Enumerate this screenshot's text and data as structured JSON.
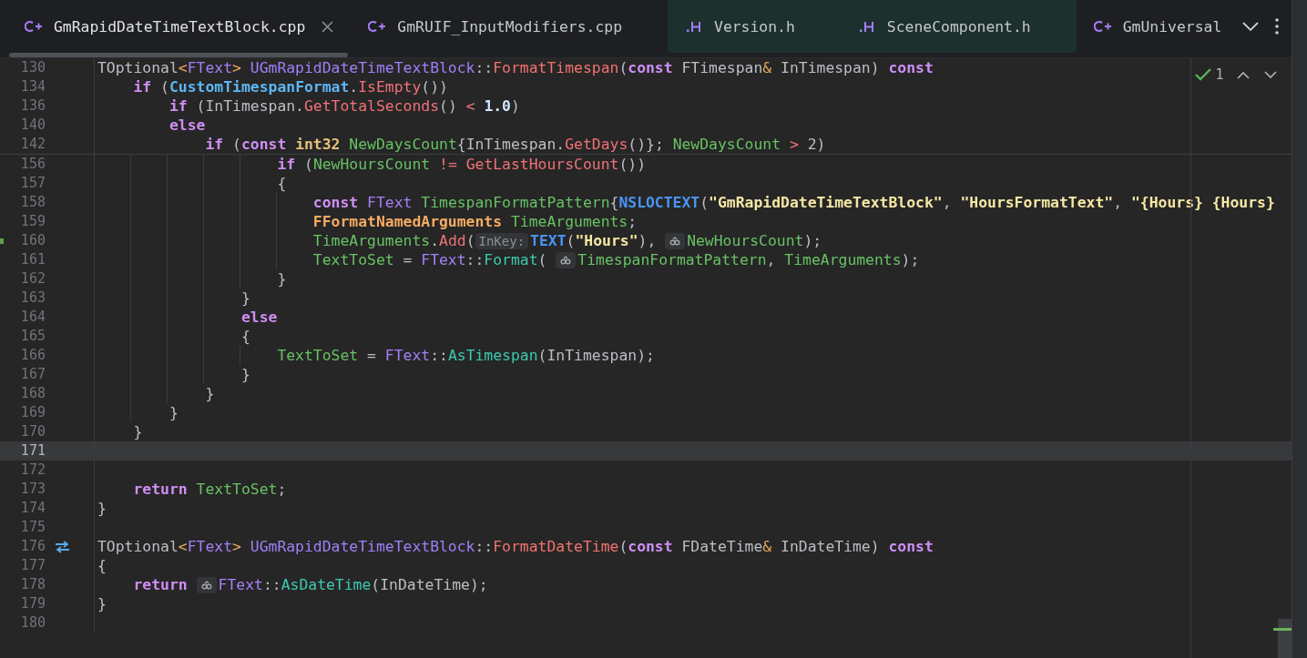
{
  "tabs": [
    {
      "label": "GmRapidDateTimeTextBlock.cpp",
      "kind": "cpp",
      "selected": true,
      "highlighted": false
    },
    {
      "label": "GmRUIF_InputModifiers.cpp",
      "kind": "cpp",
      "selected": false,
      "highlighted": false
    },
    {
      "label": "Version.h",
      "kind": "header",
      "selected": false,
      "highlighted": true
    },
    {
      "label": "SceneComponent.h",
      "kind": "header",
      "selected": false,
      "highlighted": true
    },
    {
      "label": "GmUniversal",
      "kind": "cpp",
      "selected": false,
      "highlighted": false
    }
  ],
  "inspections": {
    "count": "1"
  },
  "sticky_lines": [
    {
      "number": "130",
      "tokens": [
        {
          "kind": "plain",
          "text": "TOptional"
        },
        {
          "kind": "op",
          "text": "<"
        },
        {
          "kind": "type",
          "text": "FText"
        },
        {
          "kind": "op",
          "text": ">"
        },
        {
          "kind": "cls",
          "text": " UGmRapidDateTimeTextBlock"
        },
        {
          "kind": "plain",
          "text": "::"
        },
        {
          "kind": "fndecl",
          "text": "FormatTimespan"
        },
        {
          "kind": "plain",
          "text": "("
        },
        {
          "kind": "kw",
          "text": "const"
        },
        {
          "kind": "plain",
          "text": " FTimespan"
        },
        {
          "kind": "op",
          "text": "&"
        },
        {
          "kind": "plain",
          "text": " InTimespan) "
        },
        {
          "kind": "kw",
          "text": "const"
        }
      ]
    },
    {
      "number": "134",
      "tokens": [
        {
          "kind": "kw",
          "text": "    if"
        },
        {
          "kind": "plain",
          "text": " ("
        },
        {
          "kind": "member",
          "text": "CustomTimespanFormat"
        },
        {
          "kind": "plain",
          "text": "."
        },
        {
          "kind": "fn",
          "text": "IsEmpty"
        },
        {
          "kind": "plain",
          "text": "())"
        }
      ]
    },
    {
      "number": "136",
      "tokens": [
        {
          "kind": "kw",
          "text": "        if"
        },
        {
          "kind": "plain",
          "text": " (InTimespan."
        },
        {
          "kind": "fn",
          "text": "GetTotalSeconds"
        },
        {
          "kind": "plain",
          "text": "() "
        },
        {
          "kind": "cmp",
          "text": "<"
        },
        {
          "kind": "num",
          "text": " 1.0"
        },
        {
          "kind": "plain",
          "text": ")"
        }
      ]
    },
    {
      "number": "140",
      "tokens": [
        {
          "kind": "kw",
          "text": "        else"
        }
      ]
    },
    {
      "number": "142",
      "tokens": [
        {
          "kind": "kw",
          "text": "            if"
        },
        {
          "kind": "plain",
          "text": " ("
        },
        {
          "kind": "kw",
          "text": "const"
        },
        {
          "kind": "prim",
          "text": " int32"
        },
        {
          "kind": "local",
          "text": " NewDaysCount"
        },
        {
          "kind": "plain",
          "text": "{InTimespan."
        },
        {
          "kind": "fn",
          "text": "GetDays"
        },
        {
          "kind": "plain",
          "text": "()}; "
        },
        {
          "kind": "local",
          "text": "NewDaysCount"
        },
        {
          "kind": "cmp",
          "text": " >"
        },
        {
          "kind": "plain",
          "text": " 2)"
        }
      ]
    }
  ],
  "lines": [
    {
      "number": "156",
      "kind": "plain",
      "current": false,
      "tokens": [
        {
          "kind": "kw",
          "text": "                    if"
        },
        {
          "kind": "plain",
          "text": " ("
        },
        {
          "kind": "local",
          "text": "NewHoursCount"
        },
        {
          "kind": "cmp",
          "text": " !="
        },
        {
          "kind": "fn",
          "text": " GetLastHoursCount"
        },
        {
          "kind": "plain",
          "text": "())"
        }
      ]
    },
    {
      "number": "157",
      "kind": "plain",
      "current": false,
      "tokens": [
        {
          "kind": "plain",
          "text": "                    {"
        }
      ]
    },
    {
      "number": "158",
      "kind": "plain",
      "current": false,
      "tokens": [
        {
          "kind": "kw",
          "text": "                        const"
        },
        {
          "kind": "type",
          "text": " FText"
        },
        {
          "kind": "local",
          "text": " TimespanFormatPattern"
        },
        {
          "kind": "plain",
          "text": "{"
        },
        {
          "kind": "macro",
          "text": "NSLOCTEXT"
        },
        {
          "kind": "plain",
          "text": "("
        },
        {
          "kind": "str",
          "text": "\"GmRapidDateTimeTextBlock\""
        },
        {
          "kind": "plain",
          "text": ", "
        },
        {
          "kind": "str",
          "text": "\"HoursFormatText\""
        },
        {
          "kind": "plain",
          "text": ", "
        },
        {
          "kind": "str",
          "text": "\"{Hours} {Hours}"
        }
      ]
    },
    {
      "number": "159",
      "kind": "plain",
      "current": false,
      "tokens": [
        {
          "kind": "struct",
          "text": "                        FFormatNamedArguments"
        },
        {
          "kind": "local",
          "text": " TimeArguments"
        },
        {
          "kind": "plain",
          "text": ";"
        }
      ]
    },
    {
      "number": "160",
      "kind": "changed",
      "current": false,
      "tokens": [
        {
          "kind": "local",
          "text": "                        TimeArguments"
        },
        {
          "kind": "plain",
          "text": "."
        },
        {
          "kind": "fn",
          "text": "Add"
        },
        {
          "kind": "plain",
          "text": "("
        },
        {
          "kind": "hint",
          "text": "InKey:"
        },
        {
          "kind": "macro",
          "text": "TEXT"
        },
        {
          "kind": "plain",
          "text": "("
        },
        {
          "kind": "str",
          "text": "\"Hours\""
        },
        {
          "kind": "plain",
          "text": "), "
        },
        {
          "kind": "hint_icon"
        },
        {
          "kind": "local",
          "text": "NewHoursCount"
        },
        {
          "kind": "plain",
          "text": ");"
        }
      ]
    },
    {
      "number": "161",
      "kind": "plain",
      "current": false,
      "tokens": [
        {
          "kind": "local",
          "text": "                        TextToSet"
        },
        {
          "kind": "plain",
          "text": " = "
        },
        {
          "kind": "type",
          "text": "FText"
        },
        {
          "kind": "plain",
          "text": "::"
        },
        {
          "kind": "call",
          "text": "Format"
        },
        {
          "kind": "plain",
          "text": "( "
        },
        {
          "kind": "hint_icon"
        },
        {
          "kind": "local",
          "text": "TimespanFormatPattern"
        },
        {
          "kind": "plain",
          "text": ", "
        },
        {
          "kind": "local",
          "text": "TimeArguments"
        },
        {
          "kind": "plain",
          "text": ");"
        }
      ]
    },
    {
      "number": "162",
      "kind": "plain",
      "current": false,
      "tokens": [
        {
          "kind": "plain",
          "text": "                    }"
        }
      ]
    },
    {
      "number": "163",
      "kind": "plain",
      "current": false,
      "tokens": [
        {
          "kind": "plain",
          "text": "                }"
        }
      ]
    },
    {
      "number": "164",
      "kind": "plain",
      "current": false,
      "tokens": [
        {
          "kind": "kw",
          "text": "                else"
        }
      ]
    },
    {
      "number": "165",
      "kind": "plain",
      "current": false,
      "tokens": [
        {
          "kind": "plain",
          "text": "                {"
        }
      ]
    },
    {
      "number": "166",
      "kind": "plain",
      "current": false,
      "tokens": [
        {
          "kind": "local",
          "text": "                    TextToSet"
        },
        {
          "kind": "plain",
          "text": " = "
        },
        {
          "kind": "type",
          "text": "FText"
        },
        {
          "kind": "plain",
          "text": "::"
        },
        {
          "kind": "call",
          "text": "AsTimespan"
        },
        {
          "kind": "plain",
          "text": "(InTimespan);"
        }
      ]
    },
    {
      "number": "167",
      "kind": "plain",
      "current": false,
      "tokens": [
        {
          "kind": "plain",
          "text": "                }"
        }
      ]
    },
    {
      "number": "168",
      "kind": "plain",
      "current": false,
      "tokens": [
        {
          "kind": "plain",
          "text": "            }"
        }
      ]
    },
    {
      "number": "169",
      "kind": "plain",
      "current": false,
      "tokens": [
        {
          "kind": "plain",
          "text": "        }"
        }
      ]
    },
    {
      "number": "170",
      "kind": "plain",
      "current": false,
      "tokens": [
        {
          "kind": "plain",
          "text": "    }"
        }
      ]
    },
    {
      "number": "171",
      "kind": "plain",
      "current": true
    },
    {
      "number": "172",
      "kind": "plain",
      "current": false
    },
    {
      "number": "173",
      "kind": "plain",
      "current": false,
      "tokens": [
        {
          "kind": "kw",
          "text": "    return"
        },
        {
          "kind": "local",
          "text": " TextToSet"
        },
        {
          "kind": "plain",
          "text": ";"
        }
      ]
    },
    {
      "number": "174",
      "kind": "plain",
      "current": false,
      "tokens": [
        {
          "kind": "plain",
          "text": "}"
        }
      ]
    },
    {
      "number": "175",
      "kind": "plain",
      "current": false
    },
    {
      "number": "176",
      "kind": "override",
      "current": false,
      "tokens": [
        {
          "kind": "plain",
          "text": "TOptional"
        },
        {
          "kind": "op",
          "text": "<"
        },
        {
          "kind": "type",
          "text": "FText"
        },
        {
          "kind": "op",
          "text": ">"
        },
        {
          "kind": "cls",
          "text": " UGmRapidDateTimeTextBlock"
        },
        {
          "kind": "plain",
          "text": "::"
        },
        {
          "kind": "fndecl",
          "text": "FormatDateTime"
        },
        {
          "kind": "plain",
          "text": "("
        },
        {
          "kind": "kw",
          "text": "const"
        },
        {
          "kind": "plain",
          "text": " FDateTime"
        },
        {
          "kind": "op",
          "text": "&"
        },
        {
          "kind": "plain",
          "text": " InDateTime) "
        },
        {
          "kind": "kw",
          "text": "const"
        }
      ]
    },
    {
      "number": "177",
      "kind": "plain",
      "current": false,
      "tokens": [
        {
          "kind": "plain",
          "text": "{"
        }
      ]
    },
    {
      "number": "178",
      "kind": "plain",
      "current": false,
      "tokens": [
        {
          "kind": "kw",
          "text": "    return "
        },
        {
          "kind": "hint_icon"
        },
        {
          "kind": "type",
          "text": "FText"
        },
        {
          "kind": "plain",
          "text": "::"
        },
        {
          "kind": "call",
          "text": "AsDateTime"
        },
        {
          "kind": "plain",
          "text": "(InDateTime);"
        }
      ]
    },
    {
      "number": "179",
      "kind": "plain",
      "current": false,
      "tokens": [
        {
          "kind": "plain",
          "text": "}"
        }
      ]
    },
    {
      "number": "180",
      "kind": "plain",
      "current": false
    }
  ]
}
